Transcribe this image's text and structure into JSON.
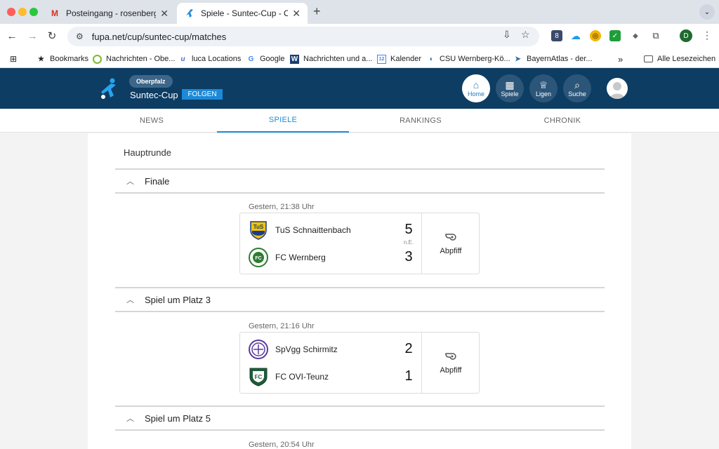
{
  "browser": {
    "tabs": [
      {
        "title": "Posteingang - rosenberg.diet",
        "favicon": "gmail-icon"
      },
      {
        "title": "Spiele - Suntec-Cup - Oberpf",
        "favicon": "fupa-icon"
      }
    ],
    "url": "fupa.net/cup/suntec-cup/matches",
    "extension_badge": "8",
    "profile_initial": "D"
  },
  "bookmarks": [
    {
      "label": "Bookmarks",
      "icon": "star-icon"
    },
    {
      "label": "Nachrichten - Obe...",
      "icon": "ring-icon"
    },
    {
      "label": "luca Locations",
      "icon": "luca-icon"
    },
    {
      "label": "Google",
      "icon": "google-icon"
    },
    {
      "label": "Nachrichten und a...",
      "icon": "w-icon"
    },
    {
      "label": "Kalender",
      "icon": "calendar-icon"
    },
    {
      "label": "CSU Wernberg-Kö...",
      "icon": "csu-icon"
    },
    {
      "label": "BayernAtlas - der...",
      "icon": "bayernatlas-icon"
    }
  ],
  "bookmarks_all": "Alle Lesezeichen",
  "header": {
    "region": "Oberpfalz",
    "cup": "Suntec-Cup",
    "follow": "FOLGEN",
    "nav": [
      {
        "label": "Home",
        "icon": "home-icon"
      },
      {
        "label": "Spiele",
        "icon": "calendar-icon"
      },
      {
        "label": "Ligen",
        "icon": "trophy-icon"
      },
      {
        "label": "Suche",
        "icon": "search-icon"
      }
    ]
  },
  "subnav": [
    "NEWS",
    "SPIELE",
    "RANKINGS",
    "CHRONIK"
  ],
  "round_title": "Hauptrunde",
  "groups": [
    {
      "title": "Finale",
      "time": "Gestern, 21:38 Uhr",
      "home": "TuS Schnaittenbach",
      "away": "FC Wernberg",
      "home_score": "5",
      "away_score": "3",
      "note": "n.E.",
      "status": "Abpfiff"
    },
    {
      "title": "Spiel um Platz 3",
      "time": "Gestern, 21:16 Uhr",
      "home": "SpVgg Schirmitz",
      "away": "FC OVI-Teunz",
      "home_score": "2",
      "away_score": "1",
      "note": "",
      "status": "Abpfiff"
    },
    {
      "title": "Spiel um Platz 5",
      "time": "Gestern, 20:54 Uhr"
    }
  ]
}
